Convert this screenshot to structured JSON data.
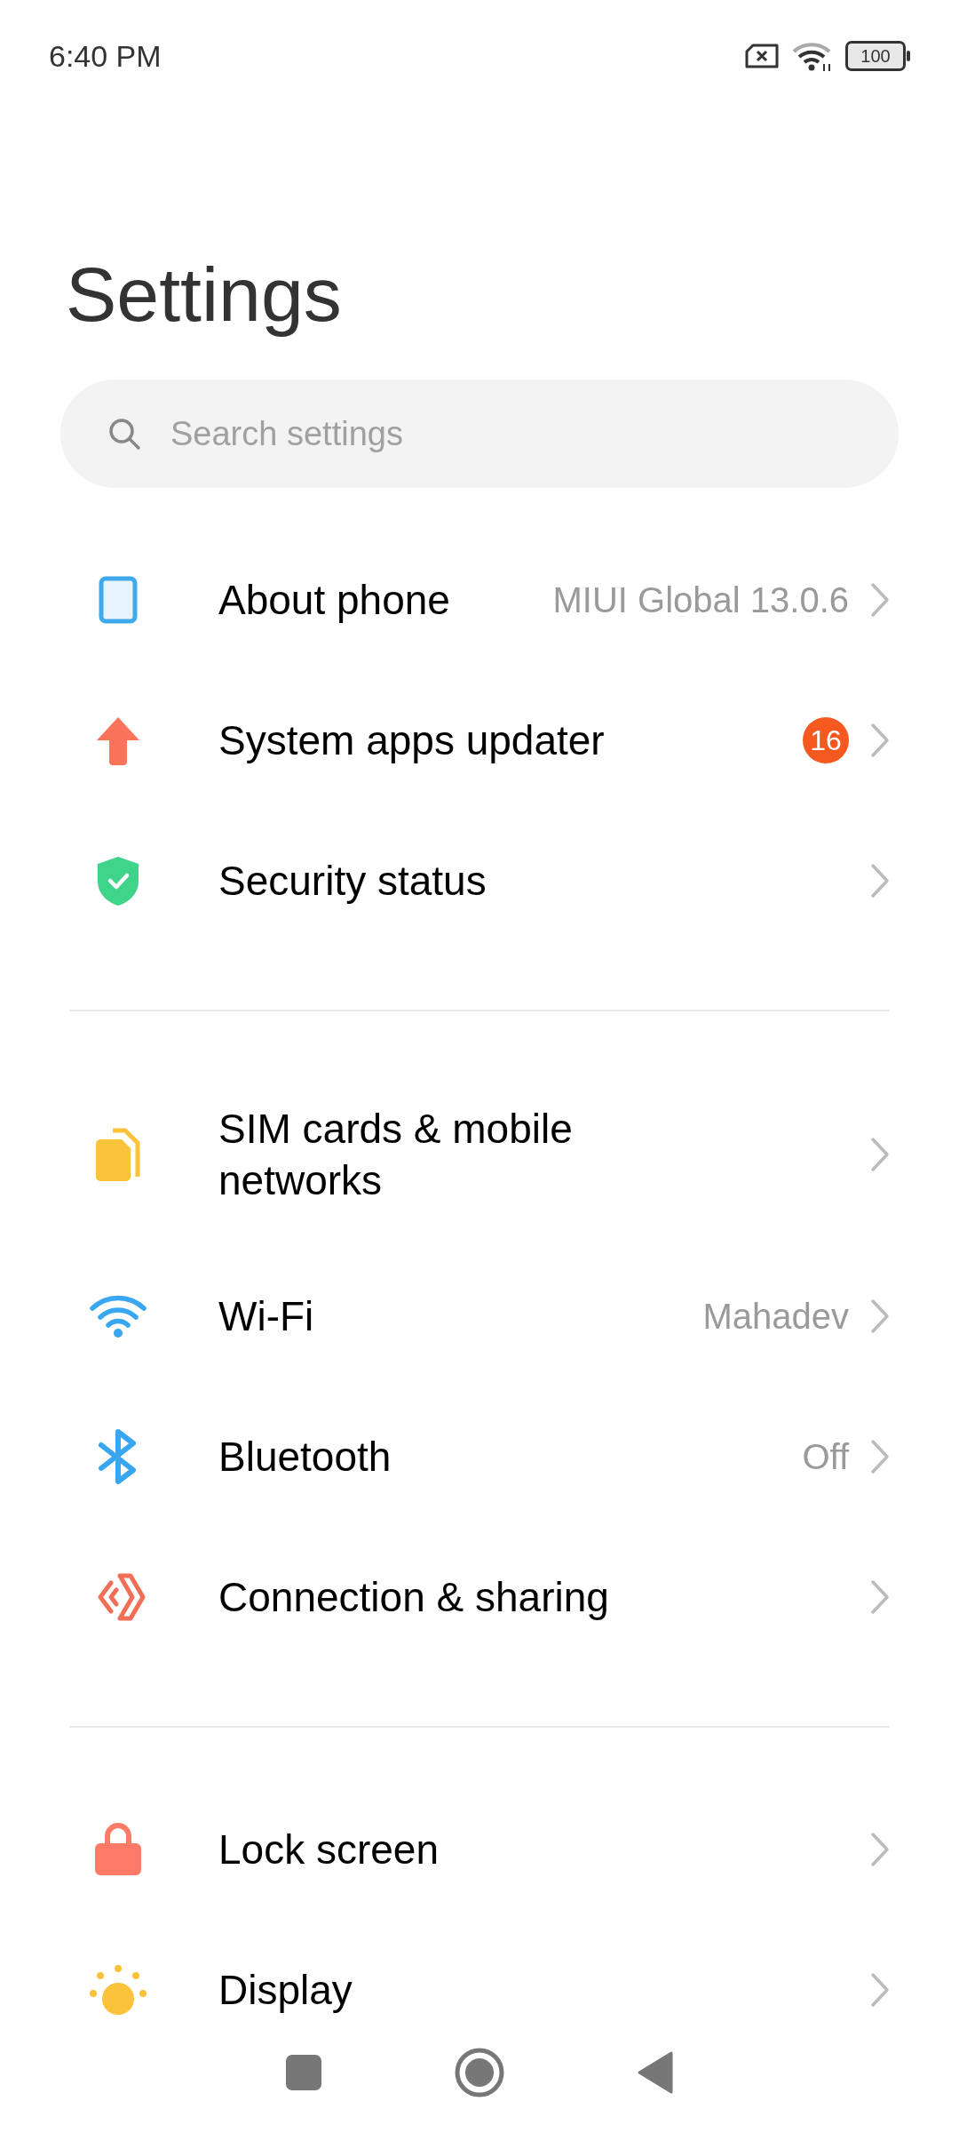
{
  "status_bar": {
    "time": "6:40 PM",
    "battery": "100"
  },
  "title": "Settings",
  "search": {
    "placeholder": "Search settings"
  },
  "sections": [
    {
      "items": [
        {
          "kind": "phone",
          "label": "About phone",
          "value": "MIUI Global 13.0.6"
        },
        {
          "kind": "update",
          "label": "System apps updater",
          "badge": "16"
        },
        {
          "kind": "shield",
          "label": "Security status"
        }
      ]
    },
    {
      "items": [
        {
          "kind": "sim",
          "label": "SIM cards & mobile networks"
        },
        {
          "kind": "wifi",
          "label": "Wi-Fi",
          "value": "Mahadev"
        },
        {
          "kind": "bluetooth",
          "label": "Bluetooth",
          "value": "Off"
        },
        {
          "kind": "share",
          "label": "Connection & sharing"
        }
      ]
    },
    {
      "items": [
        {
          "kind": "lock",
          "label": "Lock screen"
        },
        {
          "kind": "display",
          "label": "Display"
        }
      ]
    }
  ],
  "nav_bar": [
    {
      "kind": "recents"
    },
    {
      "kind": "home"
    },
    {
      "kind": "back"
    }
  ]
}
